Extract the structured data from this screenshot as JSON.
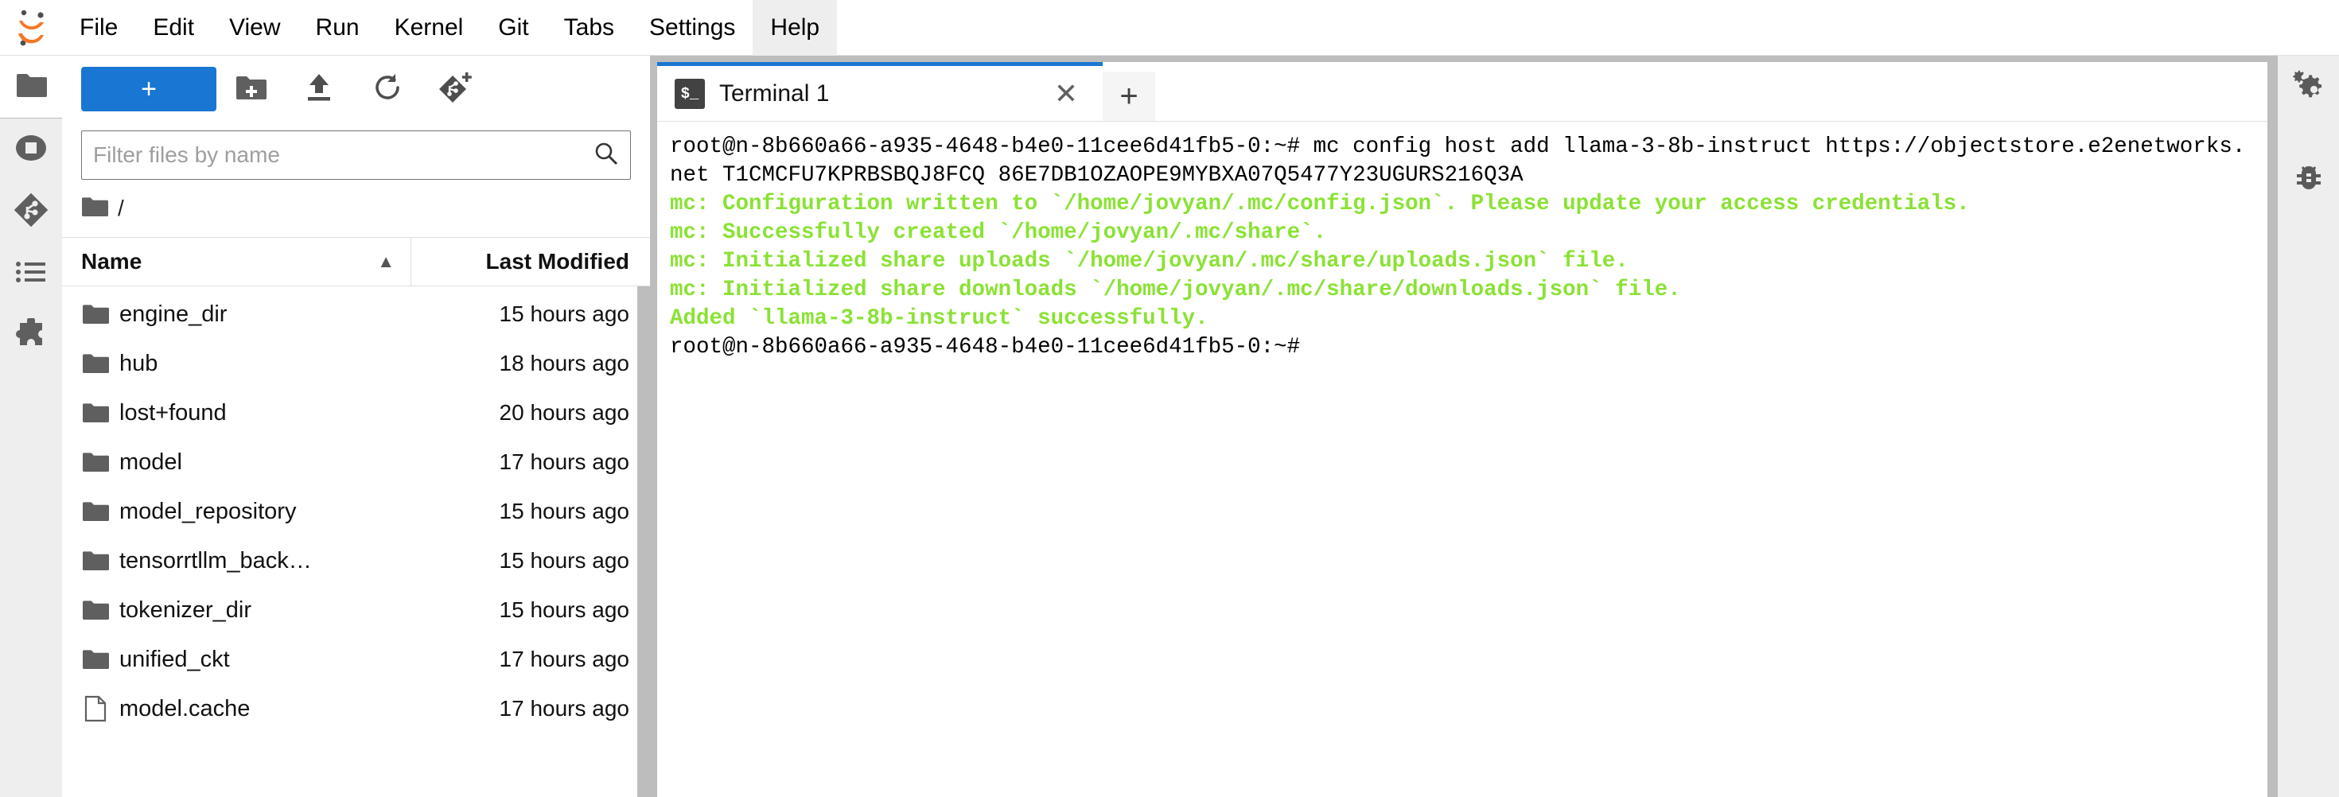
{
  "app": {
    "logo_icon": "jupyter-logo",
    "menu": [
      {
        "label": "File",
        "active": false
      },
      {
        "label": "Edit",
        "active": false
      },
      {
        "label": "View",
        "active": false
      },
      {
        "label": "Run",
        "active": false
      },
      {
        "label": "Kernel",
        "active": false
      },
      {
        "label": "Git",
        "active": false
      },
      {
        "label": "Tabs",
        "active": false
      },
      {
        "label": "Settings",
        "active": false
      },
      {
        "label": "Help",
        "active": true
      }
    ]
  },
  "activity_bar": {
    "items": [
      {
        "icon": "folder-icon",
        "name": "file-browser",
        "selected": true
      },
      {
        "icon": "stop-circle-icon",
        "name": "running-terminals-and-kernels",
        "selected": false
      },
      {
        "icon": "git-icon",
        "name": "git-panel",
        "selected": false
      },
      {
        "icon": "list-icon",
        "name": "table-of-contents",
        "selected": false
      },
      {
        "icon": "puzzle-icon",
        "name": "extension-manager",
        "selected": false
      }
    ]
  },
  "file_browser": {
    "new_launcher_label": "+",
    "toolbar_icons": [
      {
        "icon": "new-folder-icon",
        "name": "new-folder"
      },
      {
        "icon": "upload-icon",
        "name": "upload-files"
      },
      {
        "icon": "refresh-icon",
        "name": "refresh-file-list"
      },
      {
        "icon": "git-clone-icon",
        "name": "git-clone"
      }
    ],
    "filter": {
      "placeholder": "Filter files by name",
      "value": "",
      "icon": "search-icon"
    },
    "breadcrumb": {
      "root_icon": "folder-icon",
      "path": "/"
    },
    "columns": {
      "name": "Name",
      "sort_indicator": "▲",
      "last_modified": "Last Modified"
    },
    "items": [
      {
        "name": "engine_dir",
        "kind": "folder",
        "modified": "15 hours ago"
      },
      {
        "name": "hub",
        "kind": "folder",
        "modified": "18 hours ago"
      },
      {
        "name": "lost+found",
        "kind": "folder",
        "modified": "20 hours ago"
      },
      {
        "name": "model",
        "kind": "folder",
        "modified": "17 hours ago"
      },
      {
        "name": "model_repository",
        "kind": "folder",
        "modified": "15 hours ago"
      },
      {
        "name": "tensorrtllm_back…",
        "kind": "folder",
        "modified": "15 hours ago"
      },
      {
        "name": "tokenizer_dir",
        "kind": "folder",
        "modified": "15 hours ago"
      },
      {
        "name": "unified_ckt",
        "kind": "folder",
        "modified": "17 hours ago"
      },
      {
        "name": "model.cache",
        "kind": "file",
        "modified": "17 hours ago"
      }
    ]
  },
  "dock": {
    "tabs": [
      {
        "label": "Terminal 1",
        "icon": "terminal-icon",
        "icon_text": "$_",
        "active": true,
        "close_label": "✕"
      }
    ],
    "add_tab_label": "+"
  },
  "terminal": {
    "accent_green": "#8ae234",
    "lines": [
      {
        "color": "black",
        "text": "root@n-8b660a66-a935-4648-b4e0-11cee6d41fb5-0:~# mc config host add llama-3-8b-instruct https://objectstore.e2enetworks.net T1CMCFU7KPRBSBQJ8FCQ 86E7DB1OZAOPE9MYBXA07Q5477Y23UGURS216Q3A"
      },
      {
        "color": "green",
        "text": "mc: Configuration written to `/home/jovyan/.mc/config.json`. Please update your access credentials."
      },
      {
        "color": "green",
        "text": "mc: Successfully created `/home/jovyan/.mc/share`."
      },
      {
        "color": "green",
        "text": "mc: Initialized share uploads `/home/jovyan/.mc/share/uploads.json` file."
      },
      {
        "color": "green",
        "text": "mc: Initialized share downloads `/home/jovyan/.mc/share/downloads.json` file."
      },
      {
        "color": "green",
        "text": "Added `llama-3-8b-instruct` successfully."
      },
      {
        "color": "black",
        "text": "root@n-8b660a66-a935-4648-b4e0-11cee6d41fb5-0:~#"
      }
    ]
  },
  "right_bar": {
    "items": [
      {
        "icon": "gears-icon",
        "name": "property-inspector"
      },
      {
        "icon": "bug-icon",
        "name": "debugger"
      }
    ]
  }
}
